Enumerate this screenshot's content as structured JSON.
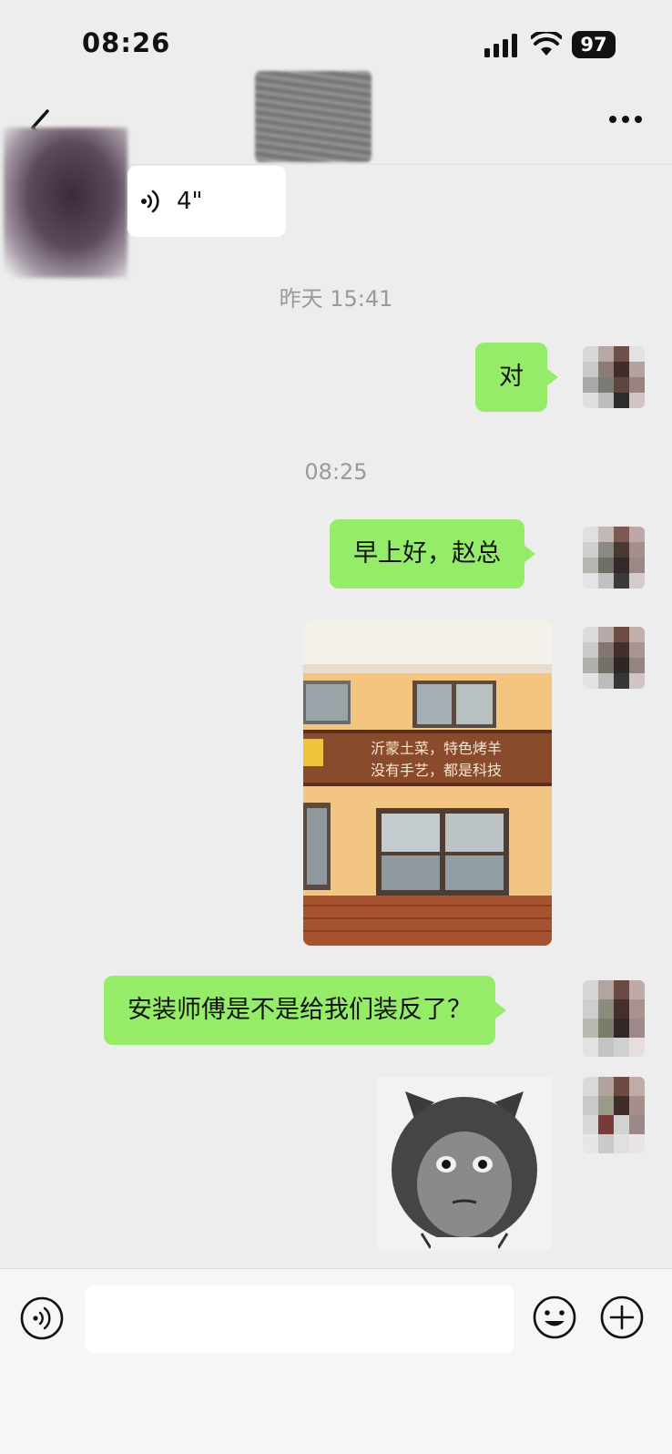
{
  "status_bar": {
    "time": "08:26",
    "battery": "97",
    "icons": [
      "signal-icon",
      "wifi-icon",
      "battery-icon"
    ]
  },
  "header": {
    "icons": [
      "back-icon",
      "more-icon"
    ]
  },
  "messages": {
    "voice": {
      "duration": "4\""
    },
    "timestamp_1": "昨天 15:41",
    "reply_1": "对",
    "timestamp_2": "08:25",
    "greeting": "早上好，赵总",
    "photo": {
      "sign_line_1": "沂蒙土菜，特色烤羊",
      "sign_line_2": "没有手艺，都是科技"
    },
    "question": "安装师傅是不是给我们装反了？"
  },
  "input_bar": {
    "placeholder": "",
    "icons": [
      "voice-toggle-icon",
      "emoji-icon",
      "plus-icon"
    ]
  },
  "colors": {
    "background": "#ededed",
    "outgoing_bubble": "#95ec69",
    "incoming_bubble": "#ffffff",
    "timestamp_text": "#9a9a9a"
  }
}
